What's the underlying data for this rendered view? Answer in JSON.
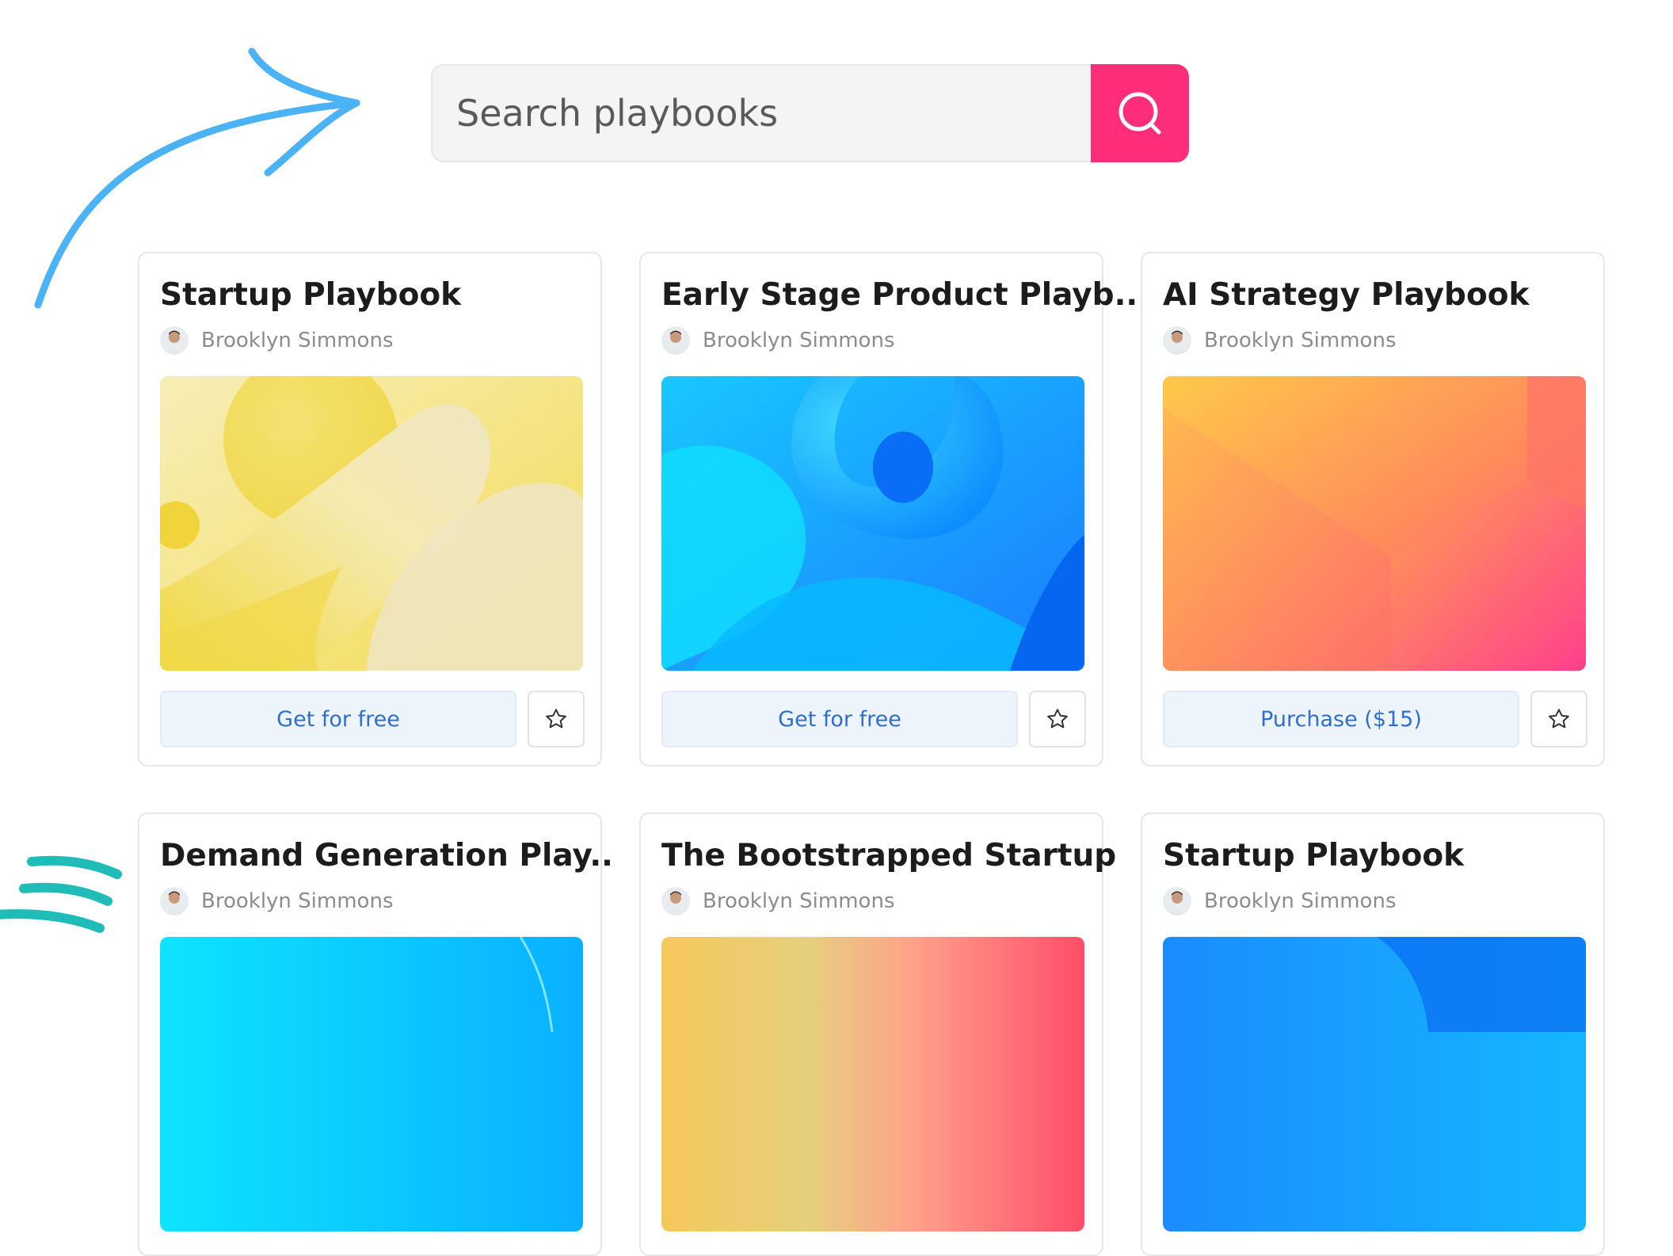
{
  "search": {
    "placeholder": "Search playbooks",
    "button_icon": "search-icon"
  },
  "colors": {
    "accent": "#ff2d7a",
    "arrow": "#4bb3f5",
    "swoosh": "#1fbcb8",
    "button_text": "#2f6fd1",
    "button_bg": "#eef4fc"
  },
  "cards": [
    {
      "title": "Startup Playbook",
      "author": "Brooklyn Simmons",
      "action": "Get for free",
      "cover": "yellow-3d-shapes"
    },
    {
      "title": "Early Stage Product Playb..",
      "author": "Brooklyn Simmons",
      "action": "Get for free",
      "cover": "blue-3d-swirl"
    },
    {
      "title": "AI Strategy Playbook",
      "author": "Brooklyn Simmons",
      "action": "Purchase ($15)",
      "cover": "orange-pink-geometric"
    },
    {
      "title": "Demand Generation Play..",
      "author": "Brooklyn Simmons",
      "cover": "cyan-gradient"
    },
    {
      "title": "The Bootstrapped Startup",
      "author": "Brooklyn Simmons",
      "cover": "yellow-pink-gradient"
    },
    {
      "title": "Startup Playbook",
      "author": "Brooklyn Simmons",
      "cover": "blue-gradient"
    }
  ]
}
